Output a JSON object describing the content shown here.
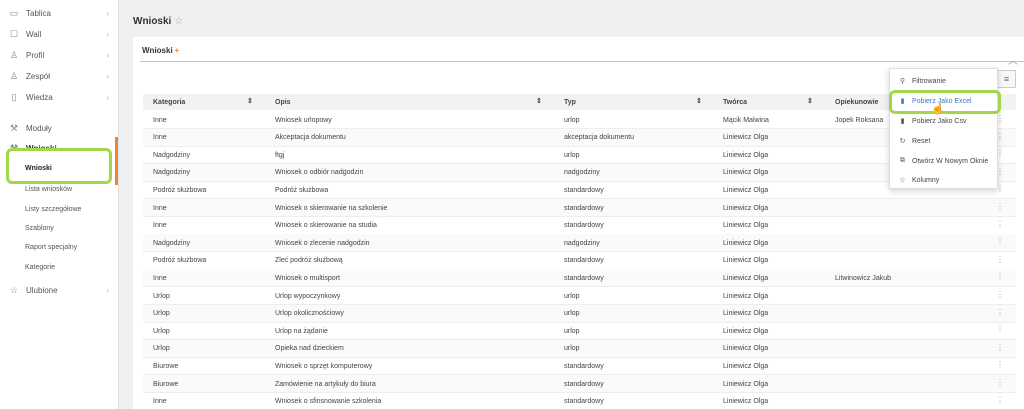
{
  "sidebar": {
    "items": [
      {
        "label": "Tablica",
        "icon": "monitor-icon"
      },
      {
        "label": "Wall",
        "icon": "chat-icon"
      },
      {
        "label": "Profil",
        "icon": "user-icon"
      },
      {
        "label": "Zespół",
        "icon": "team-icon"
      },
      {
        "label": "Wiedza",
        "icon": "book-icon"
      },
      {
        "label": "Moduły",
        "icon": "wrench-icon"
      },
      {
        "label": "Wnioski",
        "icon": "wrench-icon"
      },
      {
        "label": "Ulubione",
        "icon": "star-icon"
      }
    ],
    "subitems": [
      "Wnioski",
      "Lista wniosków",
      "Listy szczegółowe",
      "Szablony",
      "Raport specjalny",
      "Kategorie"
    ],
    "accent": "#e8843c",
    "highlight": "#a4d64c"
  },
  "header": {
    "title": "Wnioski"
  },
  "card": {
    "title": "Wnioski",
    "plus": "+"
  },
  "table": {
    "columns": [
      "Kategoria",
      "Opis",
      "Typ",
      "Twórca",
      "Opiekunowie"
    ],
    "rows": [
      [
        "Inne",
        "Wniosek urlopowy",
        "urlop",
        "Mącik Malwina",
        "Jopek Roksana"
      ],
      [
        "Inne",
        "Akceptacja dokumentu",
        "akceptacja dokumentu",
        "Liniewicz Olga",
        ""
      ],
      [
        "Nadgodziny",
        "ftgj",
        "urlop",
        "Liniewicz Olga",
        ""
      ],
      [
        "Nadgodziny",
        "Wniosek o odbiór nadgodzin",
        "nadgodziny",
        "Liniewicz Olga",
        ""
      ],
      [
        "Podróż służbowa",
        "Podróż służbowa",
        "standardowy",
        "Liniewicz Olga",
        ""
      ],
      [
        "Inne",
        "Wniosek o skierowanie na szkolenie",
        "standardowy",
        "Liniewicz Olga",
        ""
      ],
      [
        "Inne",
        "Wniosek o skierowanie na studia",
        "standardowy",
        "Liniewicz Olga",
        ""
      ],
      [
        "Nadgodziny",
        "Wniosek o zlecenie nadgodzin",
        "nadgodziny",
        "Liniewicz Olga",
        ""
      ],
      [
        "Podróż służbowa",
        "Zleć podróż służbową",
        "standardowy",
        "Liniewicz Olga",
        ""
      ],
      [
        "Inne",
        "Wniosek o multisport",
        "standardowy",
        "Liniewicz Olga",
        "Litwinowicz Jakub"
      ],
      [
        "Urlop",
        "Urlop wypoczynkowy",
        "urlop",
        "Liniewicz Olga",
        ""
      ],
      [
        "Urlop",
        "Urlop okolicznościowy",
        "urlop",
        "Liniewicz Olga",
        ""
      ],
      [
        "Urlop",
        "Urlop na żądanie",
        "urlop",
        "Liniewicz Olga",
        ""
      ],
      [
        "Urlop",
        "Opieka nad dzieckiem",
        "urlop",
        "Liniewicz Olga",
        ""
      ],
      [
        "Biurowe",
        "Wniosek o sprzęt komputerowy",
        "standardowy",
        "Liniewicz Olga",
        ""
      ],
      [
        "Biurowe",
        "Zamówienie na artykuły do biura",
        "standardowy",
        "Liniewicz Olga",
        ""
      ],
      [
        "Inne",
        "Wniosek o sfinsnowanie szkolenia",
        "standardowy",
        "Liniewicz Olga",
        ""
      ]
    ]
  },
  "dropdown": {
    "items": [
      {
        "label": "Filtrowanie",
        "icon": "search-icon"
      },
      {
        "label": "Pobierz Jako Excel",
        "icon": "file-icon"
      },
      {
        "label": "Pobierz Jako Csv",
        "icon": "file-icon"
      },
      {
        "label": "Reset",
        "icon": "refresh-icon"
      },
      {
        "label": "Otwórz W Nowym Oknie",
        "icon": "external-link-icon"
      },
      {
        "label": "Kolumny",
        "icon": "star-icon"
      }
    ],
    "highlight_color": "#3a78c9"
  }
}
